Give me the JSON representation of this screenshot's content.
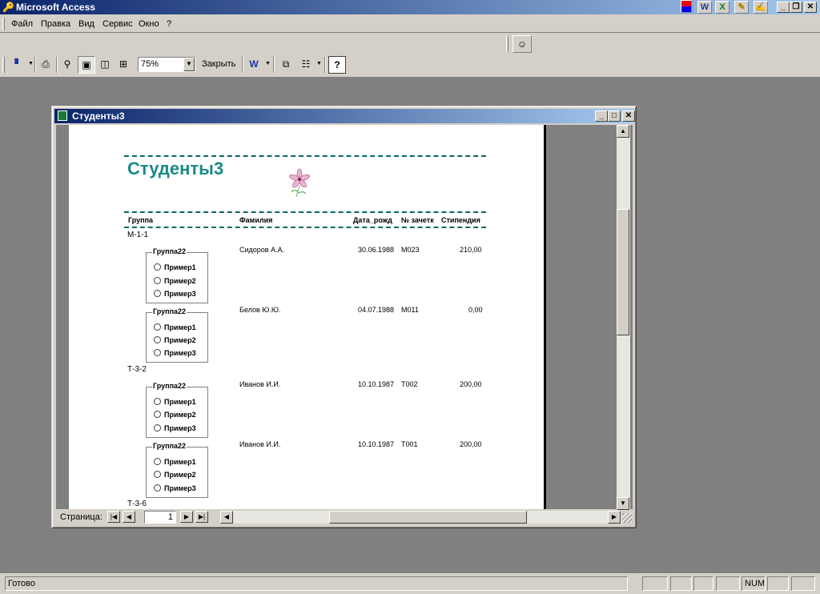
{
  "app": {
    "title": "Microsoft Access"
  },
  "menu": {
    "items": [
      "Файл",
      "Правка",
      "Вид",
      "Сервис",
      "Окно",
      "?"
    ]
  },
  "toolbar": {
    "zoom": "75%",
    "close_label": "Закрыть"
  },
  "report_window": {
    "title": "Студенты3"
  },
  "report": {
    "title": "Студенты3",
    "headers": [
      "Группа",
      "Фамилия",
      "Дата_рожд",
      "№ зачетк",
      "Стипендия"
    ],
    "groups": [
      {
        "name": "М-1-1",
        "rows": [
          {
            "surname": "Сидоров А.А.",
            "birth": "30.06.1988",
            "record": "М023",
            "stipend": "210,00",
            "frame": {
              "label": "Группа22",
              "options": [
                "Пример1",
                "Пример2",
                "Пример3"
              ]
            }
          },
          {
            "surname": "Белов Ю.Ю.",
            "birth": "04.07.1988",
            "record": "М011",
            "stipend": "0,00",
            "frame": {
              "label": "Группа22",
              "options": [
                "Пример1",
                "Пример2",
                "Пример3"
              ]
            }
          }
        ]
      },
      {
        "name": "Т-3-2",
        "rows": [
          {
            "surname": "Иванов И.И.",
            "birth": "10.10.1987",
            "record": "Т002",
            "stipend": "200,00",
            "frame": {
              "label": "Группа22",
              "options": [
                "Пример1",
                "Пример2",
                "Пример3"
              ]
            }
          },
          {
            "surname": "Иванов И.И.",
            "birth": "10.10.1987",
            "record": "Т001",
            "stipend": "200,00",
            "frame": {
              "label": "Группа22",
              "options": [
                "Пример1",
                "Пример2",
                "Пример3"
              ]
            }
          }
        ]
      },
      {
        "name": "Т-3-6",
        "rows": []
      }
    ]
  },
  "navigation": {
    "page_label": "Страница:",
    "page": "1"
  },
  "status": {
    "text": "Готово",
    "num": "NUM"
  },
  "colors": {
    "title_bar": "#0a246a",
    "report_accent": "#1a8a86",
    "workspace": "#808080"
  }
}
